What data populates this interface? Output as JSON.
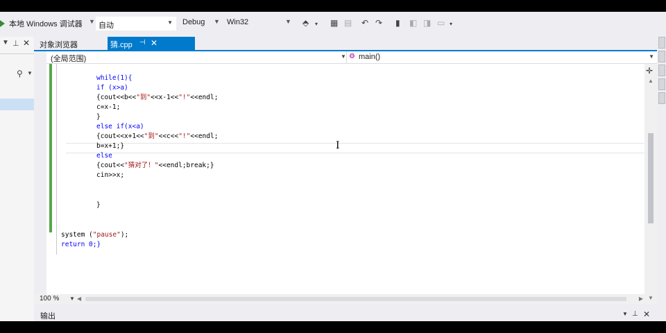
{
  "toolbar": {
    "debugger_label": "本地 Windows 调试器",
    "solution_config": "自动",
    "build_config": "Debug",
    "platform": "Win32"
  },
  "left_panel": {
    "title": "对象浏览器"
  },
  "tabs": {
    "active_label": "猜.cpp"
  },
  "navbar": {
    "scope": "(全局范围)",
    "function": "main()"
  },
  "code_lines": [
    "while(1){",
    "if (x>a)",
    "{cout<<b<<\"到\"<<x-1<<\"!\"<<endl;",
    "c=x-1;",
    "}",
    "else if(x<a)",
    "{cout<<x+1<<\"到\"<<c<<\"!\"<<endl;",
    "b=x+1;}",
    "else",
    "{cout<<\"猜对了！\"<<endl;break;}",
    "cin>>x;",
    "}",
    "system (\"pause\");",
    "return 0;}"
  ],
  "status": {
    "zoom": "100 %"
  },
  "output_panel": {
    "title": "输出"
  }
}
